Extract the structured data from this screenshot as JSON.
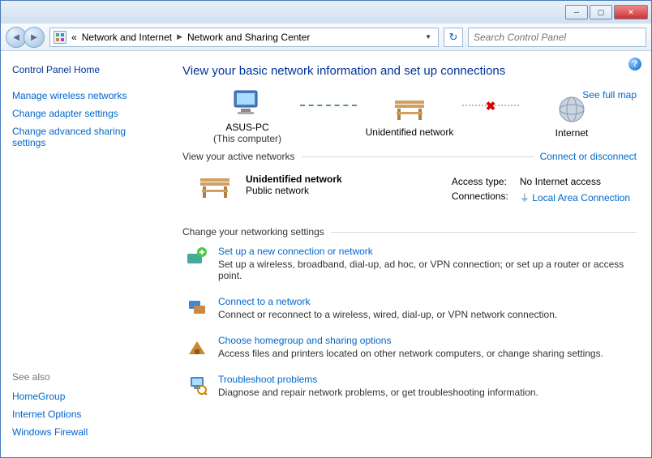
{
  "breadcrumb": {
    "prefix": "«",
    "parent": "Network and Internet",
    "current": "Network and Sharing Center"
  },
  "search": {
    "placeholder": "Search Control Panel"
  },
  "sidebar": {
    "home": "Control Panel Home",
    "links": [
      "Manage wireless networks",
      "Change adapter settings",
      "Change advanced sharing settings"
    ],
    "seealso_header": "See also",
    "seealso": [
      "HomeGroup",
      "Internet Options",
      "Windows Firewall"
    ]
  },
  "main": {
    "heading": "View your basic network information and set up connections",
    "map_link": "See full map",
    "nodes": {
      "computer": {
        "label": "ASUS-PC",
        "sub": "(This computer)"
      },
      "network": {
        "label": "Unidentified network"
      },
      "internet": {
        "label": "Internet"
      }
    },
    "active_header": "View your active networks",
    "active_link": "Connect or disconnect",
    "active": {
      "name": "Unidentified network",
      "type": "Public network",
      "access_label": "Access type:",
      "access_value": "No Internet access",
      "conn_label": "Connections:",
      "conn_value": "Local Area Connection"
    },
    "settings_header": "Change your networking settings",
    "tasks": [
      {
        "title": "Set up a new connection or network",
        "desc": "Set up a wireless, broadband, dial-up, ad hoc, or VPN connection; or set up a router or access point."
      },
      {
        "title": "Connect to a network",
        "desc": "Connect or reconnect to a wireless, wired, dial-up, or VPN network connection."
      },
      {
        "title": "Choose homegroup and sharing options",
        "desc": "Access files and printers located on other network computers, or change sharing settings."
      },
      {
        "title": "Troubleshoot problems",
        "desc": "Diagnose and repair network problems, or get troubleshooting information."
      }
    ]
  }
}
